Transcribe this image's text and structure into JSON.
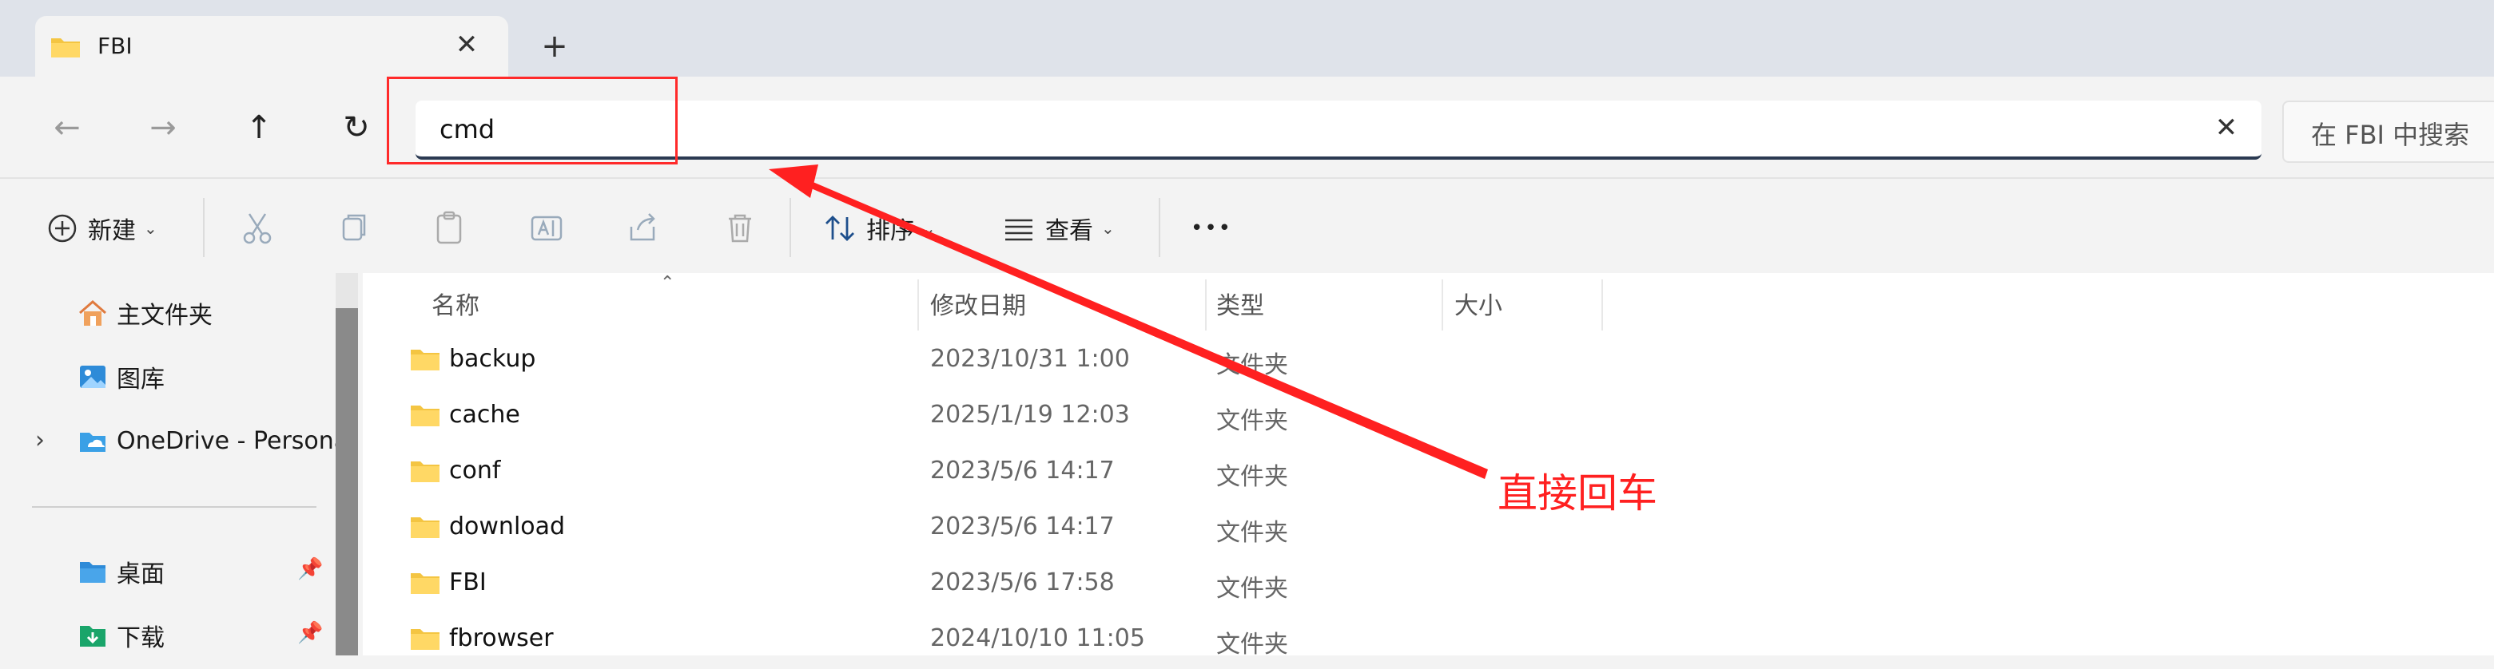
{
  "tab": {
    "title": "FBI",
    "close_glyph": "✕",
    "newtab_glyph": "+"
  },
  "nav": {
    "back_glyph": "←",
    "forward_glyph": "→",
    "up_glyph": "↑",
    "refresh_glyph": "↻",
    "address_value": "cmd",
    "clear_glyph": "✕",
    "search_placeholder": "在 FBI 中搜索"
  },
  "toolbar": {
    "new_label": "新建",
    "sort_label": "排序",
    "view_label": "查看",
    "more_glyph": "•••",
    "caret": "⌄"
  },
  "sidebar": {
    "items": [
      {
        "label": "主文件夹",
        "icon": "home-icon"
      },
      {
        "label": "图库",
        "icon": "gallery-icon"
      },
      {
        "label": "OneDrive - Persona",
        "icon": "onedrive-icon"
      },
      {
        "label": "桌面",
        "icon": "desktop-icon"
      },
      {
        "label": "下载",
        "icon": "download-icon"
      }
    ],
    "chevron": "›",
    "pin": "📌"
  },
  "columns": {
    "name": "名称",
    "date": "修改日期",
    "type": "类型",
    "size": "大小",
    "sort_caret": "⌃"
  },
  "files": [
    {
      "name": "backup",
      "date": "2023/10/31 1:00",
      "type": "文件夹"
    },
    {
      "name": "cache",
      "date": "2025/1/19 12:03",
      "type": "文件夹"
    },
    {
      "name": "conf",
      "date": "2023/5/6 14:17",
      "type": "文件夹"
    },
    {
      "name": "download",
      "date": "2023/5/6 14:17",
      "type": "文件夹"
    },
    {
      "name": "FBI",
      "date": "2023/5/6 17:58",
      "type": "文件夹"
    },
    {
      "name": "fbrowser",
      "date": "2024/10/10 11:05",
      "type": "文件夹"
    }
  ],
  "annotation": {
    "text": "直接回车",
    "color": "#ff2020"
  },
  "colors": {
    "accent_underline": "#2b3a52",
    "folder": "#f4c542",
    "highlight": "#ff2a2a"
  }
}
